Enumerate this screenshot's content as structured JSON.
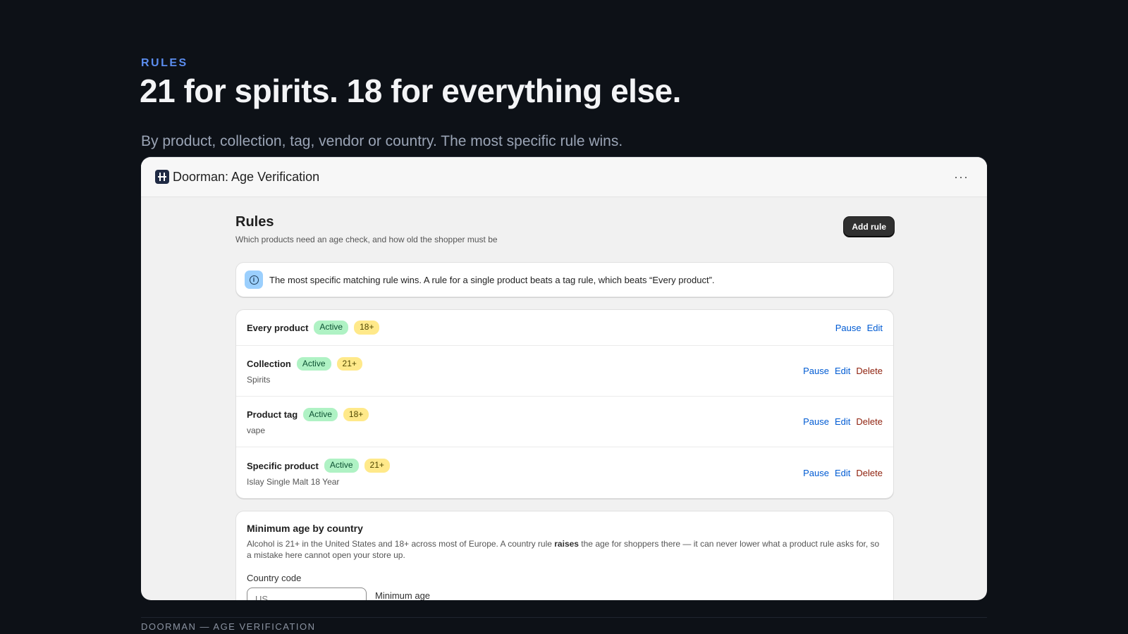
{
  "hero": {
    "eyebrow": "RULES",
    "title": "21 for spirits. 18 for everything else.",
    "subtitle": "By product, collection, tag, vendor or country. The most specific rule wins."
  },
  "window": {
    "app_icon": "app-logo-icon",
    "title": "Doorman: Age Verification",
    "more_icon": "more-horizontal-icon",
    "more_label": "···"
  },
  "page": {
    "title": "Rules",
    "description": "Which products need an age check, and how old the shopper must be",
    "add_button": "Add rule"
  },
  "banner": {
    "icon": "info-icon",
    "text": "The most specific matching rule wins. A rule for a single product beats a tag rule, which beats “Every product”."
  },
  "rules": [
    {
      "name": "Every product",
      "status": "Active",
      "age": "18+",
      "target": "",
      "actions": [
        "Pause",
        "Edit"
      ]
    },
    {
      "name": "Collection",
      "status": "Active",
      "age": "21+",
      "target": "Spirits",
      "actions": [
        "Pause",
        "Edit",
        "Delete"
      ]
    },
    {
      "name": "Product tag",
      "status": "Active",
      "age": "18+",
      "target": "vape",
      "actions": [
        "Pause",
        "Edit",
        "Delete"
      ]
    },
    {
      "name": "Specific product",
      "status": "Active",
      "age": "21+",
      "target": "Islay Single Malt 18 Year",
      "actions": [
        "Pause",
        "Edit",
        "Delete"
      ]
    }
  ],
  "country": {
    "title": "Minimum age by country",
    "desc_before": "Alcohol is 21+ in the United States and 18+ across most of Europe. A country rule ",
    "desc_bold": "raises",
    "desc_after": " the age for shoppers there — it can never lower what a product rule asks for, so a mistake here cannot open your store up.",
    "country_label": "Country code",
    "country_placeholder": "US",
    "min_age_label": "Minimum age"
  },
  "footer": {
    "text": "DOORMAN — AGE VERIFICATION"
  },
  "colors": {
    "background": "#0d1117",
    "eyebrow": "#5b8def",
    "link": "#005bd3",
    "danger": "#8e1f0b",
    "active_badge": "#aff2c4",
    "age_badge": "#ffe98a"
  }
}
